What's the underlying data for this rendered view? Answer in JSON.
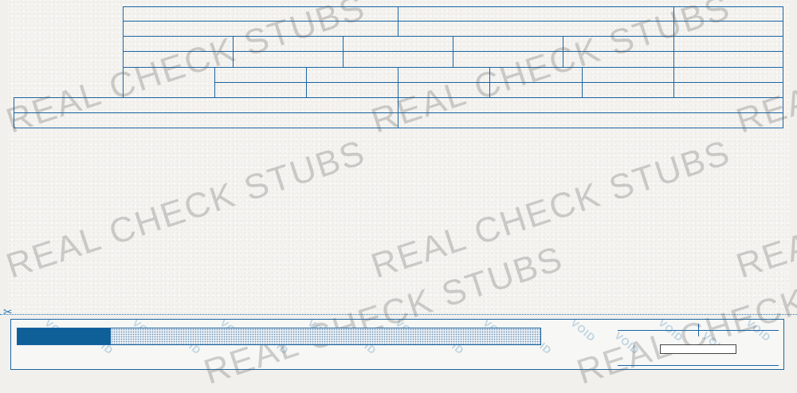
{
  "watermark": {
    "text": "REAL CHECK STUBS",
    "color": "#5f5f5f"
  },
  "check": {
    "void_text": "VOID",
    "accent_color": "#1b65a3",
    "amount_bar_fill_color": "#0f5f99"
  },
  "icons": {
    "cut_marker": "scissors-icon"
  }
}
